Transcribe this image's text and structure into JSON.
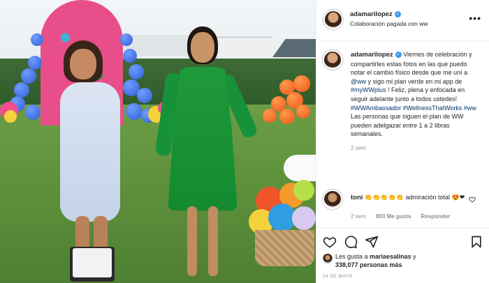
{
  "post": {
    "author": {
      "username": "adamarilopez",
      "verified": true,
      "subtitle": "Colaboración pagada con ww"
    },
    "more_label": "•••",
    "caption": {
      "username": "adamarilopez",
      "parts": [
        " Viernes de celebración y compartirles estas fotos en las que puedo notar el cambio físico desde que me uní a ",
        "@ww",
        " y sigo mi plan verde en mi app de ",
        "#myWWplus",
        " ! Feliz, plena y enfocada en seguir adelante junto a todos ustedes! ",
        "#WWAmbassador",
        " ",
        "#WellnessThatWorks",
        " ",
        "#ww",
        " Las personas que siguen el plan de WW pueden adelgazar entre 1 a 2 libras semanales."
      ],
      "time": "2 sem"
    },
    "comment": {
      "username": "toni",
      "text_a": " 👏👏👏👏👏 admiración total ",
      "text_b": "😍❤",
      "time": "2 sem",
      "likes": "893 Me gusta",
      "reply": "Responder",
      "like_icon": "heart-outline-icon"
    },
    "actions": {
      "like_icon": "heart-outline-icon",
      "comment_icon": "comment-bubble-icon",
      "share_icon": "paper-plane-icon",
      "save_icon": "bookmark-icon"
    },
    "likes": {
      "line1_prefix": "Les gusta a ",
      "line1_user": "mariaesalinas",
      "line1_suffix": " y",
      "line2": "338,077 personas más"
    },
    "date": "14 DE MAYO"
  },
  "colors": {
    "link": "#00376b",
    "verified": "#3897f0",
    "muted": "#8e8e8e",
    "text": "#262626"
  }
}
